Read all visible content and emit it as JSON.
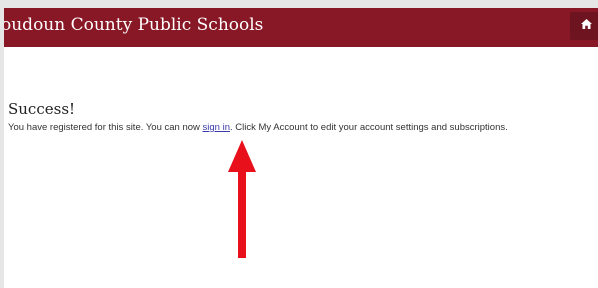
{
  "header": {
    "title": "oudoun County Public Schools",
    "home_icon": "home-icon",
    "background_color": "#891827"
  },
  "main": {
    "heading": "Success!",
    "message_before": "You have registered for this site. You can now ",
    "sign_in_link": "sign in",
    "message_after": ". Click My Account to edit your account settings and subscriptions."
  },
  "annotation": {
    "arrow_icon": "red-arrow-up-icon",
    "arrow_color": "#e8101a"
  }
}
